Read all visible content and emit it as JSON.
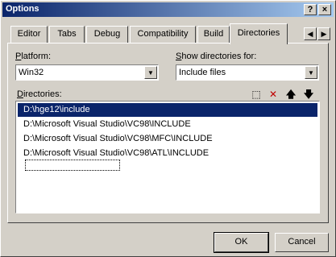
{
  "window": {
    "title": "Options",
    "help_glyph": "?",
    "close_glyph": "×"
  },
  "tabs": [
    {
      "label": "Editor"
    },
    {
      "label": "Tabs"
    },
    {
      "label": "Debug"
    },
    {
      "label": "Compatibility"
    },
    {
      "label": "Build"
    },
    {
      "label": "Directories",
      "active": true
    }
  ],
  "tab_scroll": {
    "left_glyph": "◀",
    "right_glyph": "▶"
  },
  "platform": {
    "label_prefix": "P",
    "label_rest": "latform:",
    "value": "Win32"
  },
  "show_dirs": {
    "label_prefix": "S",
    "label_rest": "how directories for:",
    "value": "Include files"
  },
  "directories": {
    "label_prefix": "D",
    "label_rest": "irectories:",
    "tools": [
      {
        "icon": "new-folder-icon",
        "glyph": "⬚"
      },
      {
        "icon": "delete-icon",
        "glyph": "✕",
        "color": "#c00000"
      },
      {
        "icon": "move-up-icon",
        "glyph": "🡅"
      },
      {
        "icon": "move-down-icon",
        "glyph": "🡇"
      }
    ],
    "items": [
      "D:\\hge12\\include",
      "D:\\Microsoft Visual Studio\\VC98\\INCLUDE",
      "D:\\Microsoft Visual Studio\\VC98\\MFC\\INCLUDE",
      "D:\\Microsoft Visual Studio\\VC98\\ATL\\INCLUDE"
    ],
    "selected_index": 0
  },
  "buttons": {
    "ok": "OK",
    "cancel": "Cancel"
  },
  "colors": {
    "selection": "#0a246a",
    "titlebar_start": "#0a246a",
    "titlebar_end": "#a6caf0"
  }
}
